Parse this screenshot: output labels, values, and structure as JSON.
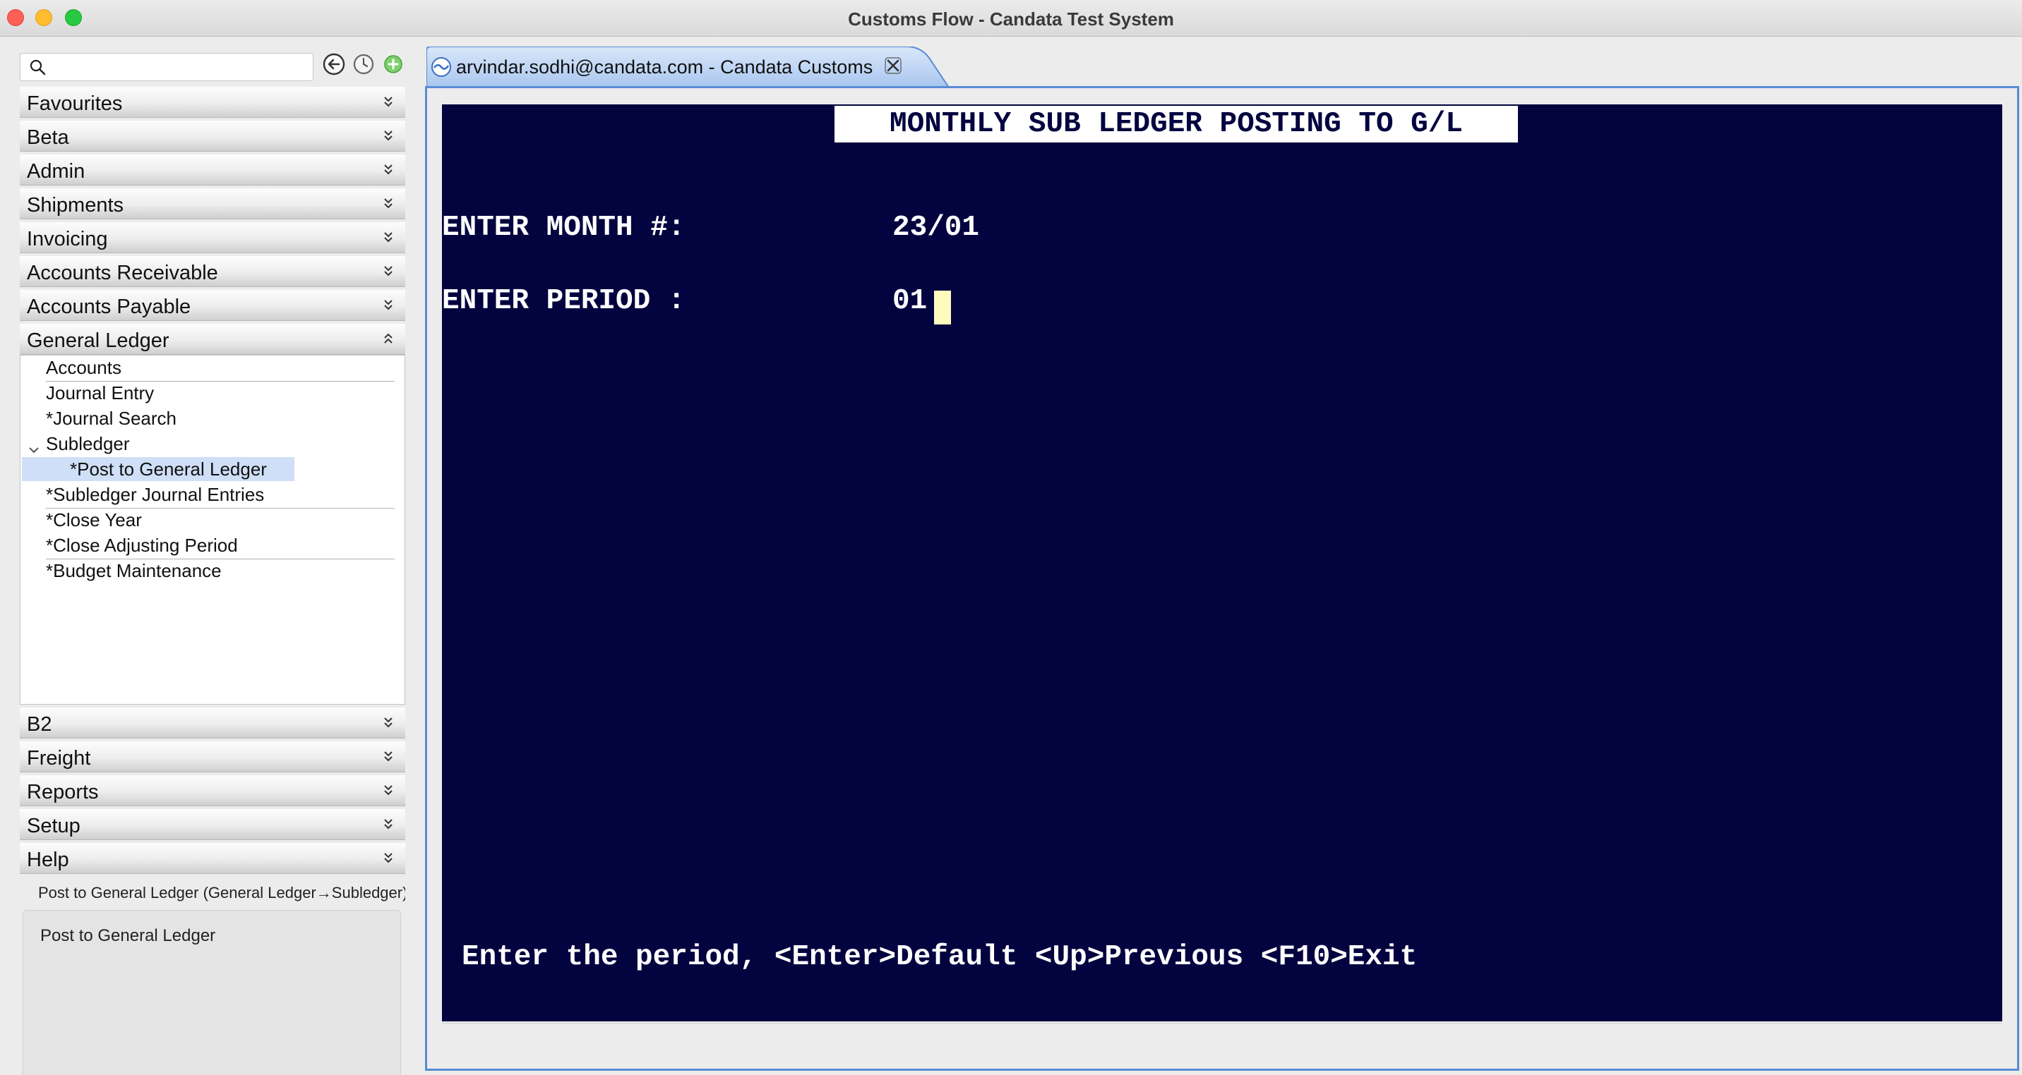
{
  "window": {
    "title": "Customs Flow - Candata Test System"
  },
  "sidebar": {
    "search": {
      "placeholder": "",
      "value": ""
    },
    "sections_top": [
      {
        "label": "Favourites"
      },
      {
        "label": "Beta"
      },
      {
        "label": "Admin"
      },
      {
        "label": "Shipments"
      },
      {
        "label": "Invoicing"
      },
      {
        "label": "Accounts Receivable"
      },
      {
        "label": "Accounts Payable"
      },
      {
        "label": "General Ledger",
        "expanded": true
      }
    ],
    "gl_items": [
      {
        "label": "Accounts"
      },
      {
        "label": "Journal Entry"
      },
      {
        "label": "*Journal Search"
      },
      {
        "label": "Subledger"
      },
      {
        "label": "*Post to General Ledger",
        "selected": true
      },
      {
        "label": "*Subledger Journal Entries"
      },
      {
        "label": "*Close Year"
      },
      {
        "label": "*Close Adjusting Period"
      },
      {
        "label": "*Budget Maintenance"
      }
    ],
    "sections_bottom": [
      {
        "label": "B2"
      },
      {
        "label": "Freight"
      },
      {
        "label": "Reports"
      },
      {
        "label": "Setup"
      },
      {
        "label": "Help"
      }
    ],
    "status_path": "Post to General Ledger (General Ledger→Subledger)",
    "description": "Post to General Ledger"
  },
  "tab": {
    "label": "arvindar.sodhi@candata.com - Candata Customs"
  },
  "terminal": {
    "title": "MONTHLY SUB LEDGER POSTING TO G/L",
    "month_label": "ENTER MONTH #:",
    "month_value": "23/01",
    "period_label": "ENTER PERIOD :",
    "period_value": "01",
    "help_line": "Enter the period, <Enter>Default <Up>Previous <F10>Exit"
  },
  "colors": {
    "terminal_bg": "#03033f",
    "cursor": "#fffbbe",
    "selection": "#cfdff7",
    "editor_border": "#5a8bd3"
  }
}
